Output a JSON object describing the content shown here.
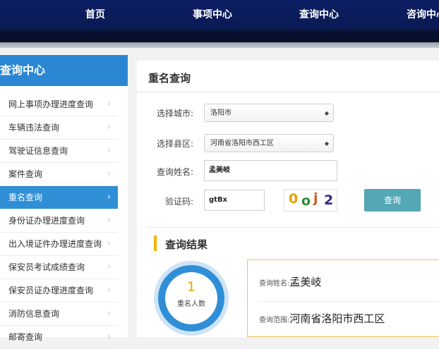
{
  "nav": {
    "items": [
      "首页",
      "事项中心",
      "查询中心",
      "咨询中心"
    ]
  },
  "sidebar": {
    "title": "查询中心",
    "items": [
      {
        "label": "网上事项办理进度查询"
      },
      {
        "label": "车辆违法查询"
      },
      {
        "label": "驾驶证信息查询"
      },
      {
        "label": "案件查询"
      },
      {
        "label": "重名查询",
        "active": true
      },
      {
        "label": "身份证办理进度查询"
      },
      {
        "label": "出入境证件办理进度查询"
      },
      {
        "label": "保安员考试成绩查询"
      },
      {
        "label": "保安员证办理进度查询"
      },
      {
        "label": "消防信息查询"
      },
      {
        "label": "邮寄查询"
      }
    ],
    "chevron": "›"
  },
  "form": {
    "title": "重名查询",
    "city_label": "选择城市:",
    "city_value": "洛阳市",
    "district_label": "选择县区:",
    "district_value": "河南省洛阳市西工区",
    "name_label": "查询姓名:",
    "name_value": "孟美岐",
    "captcha_label": "验证码:",
    "captcha_value": "gtBx",
    "captcha_chars": [
      "0",
      "o",
      "j",
      "2"
    ],
    "query_button": "查询",
    "select_arrows": "◆"
  },
  "result": {
    "title": "查询结果",
    "count": "1",
    "count_label": "重名人数",
    "name_label": "查询姓名:",
    "name_value": "孟美岐",
    "scope_label": "查询范围:",
    "scope_value": "河南省洛阳市西工区"
  },
  "colors": {
    "nav_bg": "#0d1f64",
    "sidebar_header": "#2b87d3",
    "active_item": "#2f8fd6",
    "query_button": "#54a7b4",
    "accent_yellow": "#f2b500"
  }
}
